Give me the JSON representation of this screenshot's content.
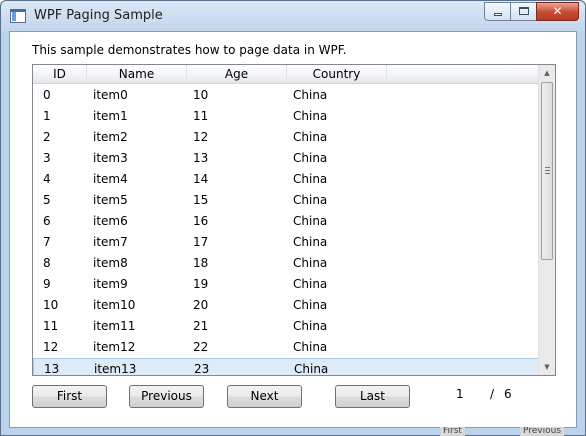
{
  "window": {
    "title": "WPF Paging Sample",
    "close_glyph": "✕"
  },
  "description": "This sample demonstrates how to page data in WPF.",
  "grid": {
    "columns": [
      "ID",
      "Name",
      "Age",
      "Country"
    ],
    "rows": [
      [
        "0",
        "item0",
        "10",
        "China"
      ],
      [
        "1",
        "item1",
        "11",
        "China"
      ],
      [
        "2",
        "item2",
        "12",
        "China"
      ],
      [
        "3",
        "item3",
        "13",
        "China"
      ],
      [
        "4",
        "item4",
        "14",
        "China"
      ],
      [
        "5",
        "item5",
        "15",
        "China"
      ],
      [
        "6",
        "item6",
        "16",
        "China"
      ],
      [
        "7",
        "item7",
        "17",
        "China"
      ],
      [
        "8",
        "item8",
        "18",
        "China"
      ],
      [
        "9",
        "item9",
        "19",
        "China"
      ],
      [
        "10",
        "item10",
        "20",
        "China"
      ],
      [
        "11",
        "item11",
        "21",
        "China"
      ],
      [
        "12",
        "item12",
        "22",
        "China"
      ],
      [
        "13",
        "item13",
        "23",
        "China"
      ]
    ],
    "selected_row": 13,
    "scroll_up_glyph": "▲",
    "scroll_down_glyph": "▼"
  },
  "buttons": {
    "first": "First",
    "previous": "Previous",
    "next": "Next",
    "last": "Last"
  },
  "paging": {
    "current": "1",
    "separator": "/",
    "total": "6"
  },
  "background_fragments": [
    "First",
    "Previous"
  ],
  "colors": {
    "selection": "#dcebf7",
    "close_button": "#c74a32"
  }
}
